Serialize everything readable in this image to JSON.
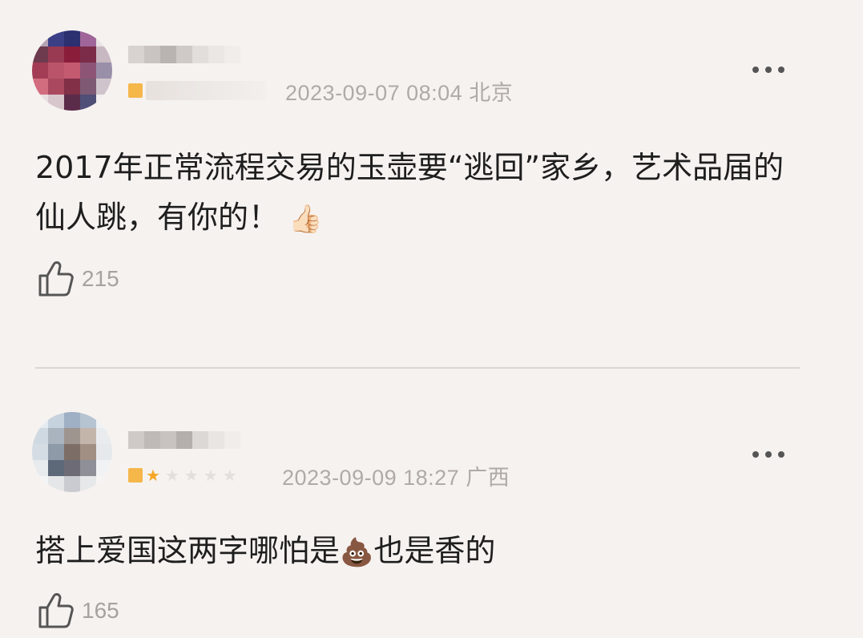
{
  "comments": [
    {
      "timestamp": "2023-09-07 08:04",
      "location": "北京",
      "text": "2017年正常流程交易的玉壶要“逃回”家乡，艺术品届的仙人跳，有你的！",
      "emoji": "👍🏻",
      "likes": "215"
    },
    {
      "timestamp": "2023-09-09 18:27",
      "location": "广西",
      "text_before": "搭上爱国这两字哪怕是",
      "emoji": "💩",
      "text_after": "也是香的",
      "likes": "165"
    }
  ],
  "icons": {
    "more": "more-dots-icon",
    "like": "thumbs-up-icon"
  }
}
